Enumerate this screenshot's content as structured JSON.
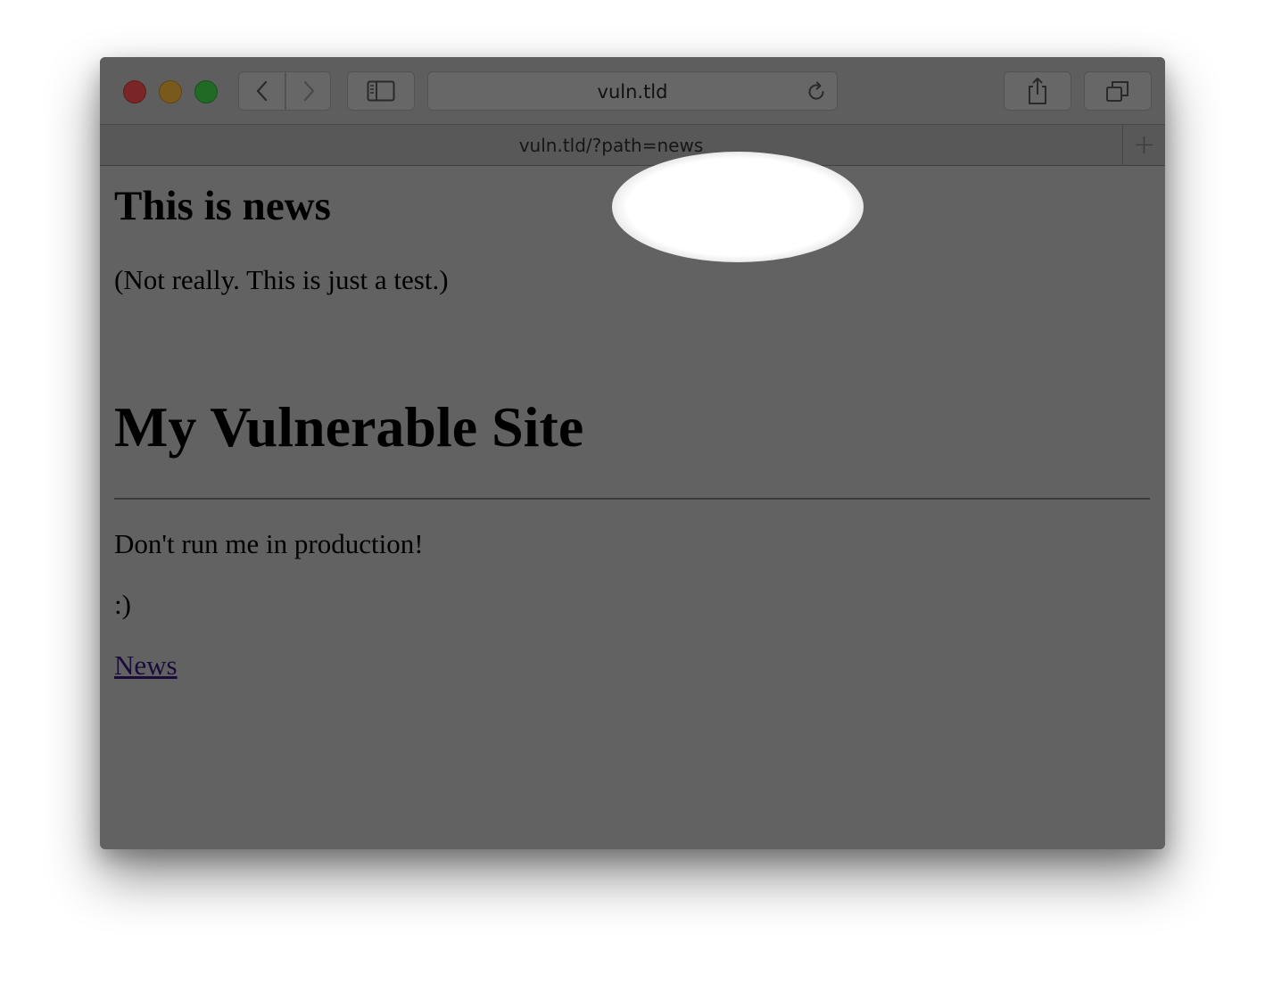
{
  "browser": {
    "address_bar_text": "vuln.tld",
    "tab_title": "vuln.tld/?path=news",
    "new_tab_label": "+"
  },
  "page": {
    "heading_news": "This is news",
    "news_note": "(Not really. This is just a test.)",
    "site_title": "My Vulnerable Site",
    "warning": "Don't run me in production!",
    "smiley": ":)",
    "nav_link": "News"
  },
  "icons": {
    "back": "chevron-left-icon",
    "forward": "chevron-right-icon",
    "sidebar": "sidebar-icon",
    "reload": "reload-icon",
    "share": "share-icon",
    "tabs": "tabs-overview-icon",
    "new_tab": "plus-icon"
  },
  "colors": {
    "window_bg": "#626262",
    "link": "#1a0b3a",
    "highlight": "#ffffff"
  }
}
